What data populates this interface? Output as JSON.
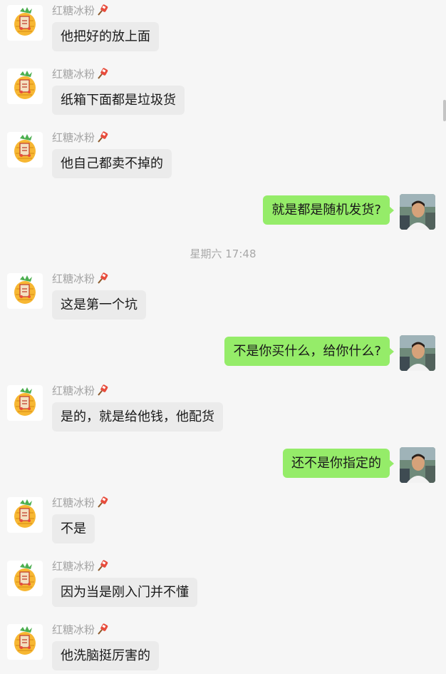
{
  "sender_name": "红糖冰粉",
  "timestamp": "星期六 17:48",
  "messages": [
    {
      "dir": "in",
      "text": "他把好的放上面"
    },
    {
      "dir": "in",
      "text": "纸箱下面都是垃圾货"
    },
    {
      "dir": "in",
      "text": "他自己都卖不掉的"
    },
    {
      "dir": "out",
      "text": "就是都是随机发货?"
    },
    {
      "dir": "in",
      "text": "这是第一个坑"
    },
    {
      "dir": "out",
      "text": "不是你买什么，给你什么?"
    },
    {
      "dir": "in",
      "text": "是的，就是给他钱，他配货"
    },
    {
      "dir": "out",
      "text": "还不是你指定的"
    },
    {
      "dir": "in",
      "text": "不是"
    },
    {
      "dir": "in",
      "text": "因为当是刚入门并不懂"
    },
    {
      "dir": "in",
      "text": "他洗脑挺厉害的"
    }
  ],
  "colors": {
    "background": "#f6f6f6",
    "incoming_bubble": "#ebebeb",
    "outgoing_bubble": "#95ec69",
    "meta_text": "#a4a4a4"
  },
  "icons": {
    "incoming_avatar": "cartoon-pineapple-avatar-icon",
    "outgoing_avatar": "user-photo-avatar",
    "sender_tag": "ice-cream-sticker-icon"
  }
}
